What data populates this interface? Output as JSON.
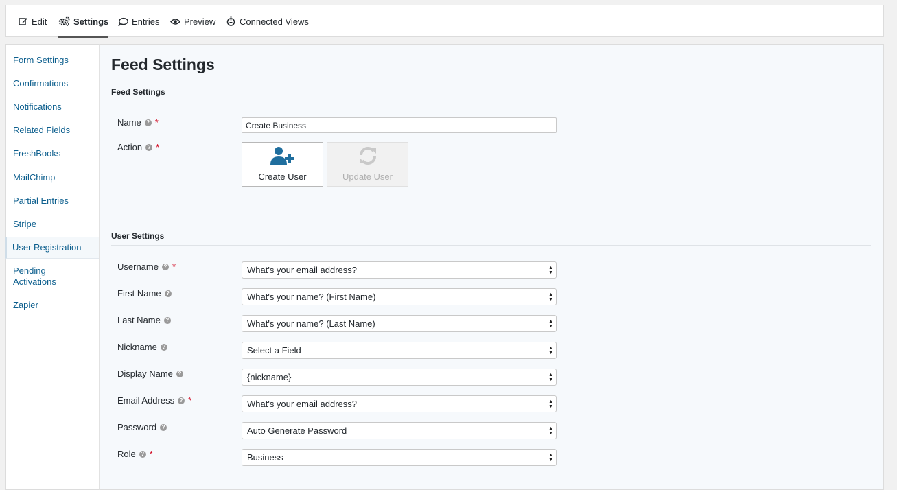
{
  "toolbar": {
    "tabs": [
      {
        "label": "Edit",
        "icon": "edit-icon"
      },
      {
        "label": "Settings",
        "icon": "gears-icon"
      },
      {
        "label": "Entries",
        "icon": "comment-icon"
      },
      {
        "label": "Preview",
        "icon": "eye-icon"
      },
      {
        "label": "Connected Views",
        "icon": "gravityview-icon"
      }
    ],
    "active": "Settings"
  },
  "sidebar": {
    "items": [
      {
        "label": "Form Settings"
      },
      {
        "label": "Confirmations"
      },
      {
        "label": "Notifications"
      },
      {
        "label": "Related Fields"
      },
      {
        "label": "FreshBooks"
      },
      {
        "label": "MailChimp"
      },
      {
        "label": "Partial Entries"
      },
      {
        "label": "Stripe"
      },
      {
        "label": "User Registration"
      },
      {
        "label": "Pending Activations"
      },
      {
        "label": "Zapier"
      }
    ],
    "active": "User Registration"
  },
  "main": {
    "title": "Feed Settings",
    "feed_section": {
      "title": "Feed Settings",
      "name_label": "Name",
      "name_value": "Create Business",
      "action_label": "Action",
      "actions": [
        {
          "label": "Create User",
          "icon": "add-user-icon",
          "enabled": true
        },
        {
          "label": "Update User",
          "icon": "refresh-icon",
          "enabled": false
        }
      ]
    },
    "user_section": {
      "title": "User Settings",
      "fields": [
        {
          "label": "Username",
          "required": true,
          "value": "What's your email address?"
        },
        {
          "label": "First Name",
          "required": false,
          "value": "What's your name? (First Name)"
        },
        {
          "label": "Last Name",
          "required": false,
          "value": "What's your name? (Last Name)"
        },
        {
          "label": "Nickname",
          "required": false,
          "value": "Select a Field"
        },
        {
          "label": "Display Name",
          "required": false,
          "value": "{nickname}"
        },
        {
          "label": "Email Address",
          "required": true,
          "value": "What's your email address?"
        },
        {
          "label": "Password",
          "required": false,
          "value": "Auto Generate Password"
        },
        {
          "label": "Role",
          "required": true,
          "value": "Business"
        }
      ]
    },
    "required_mark": "*",
    "help_mark": "?"
  },
  "colors": {
    "link": "#0d5f8e",
    "required": "#d0021b",
    "icon_blue": "#1f6e9e"
  }
}
